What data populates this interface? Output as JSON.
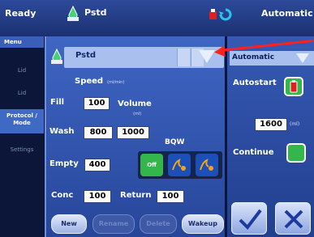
{
  "top_bar": {
    "status": "Ready",
    "program": "Pstd",
    "mode": "Automatic"
  },
  "sidebar": {
    "menu_label": "Menu",
    "items": [
      {
        "label": "Lid"
      },
      {
        "label": "Lid"
      },
      {
        "label": "Protocol / Mode"
      },
      {
        "label": "Settings"
      }
    ]
  },
  "program_panel": {
    "program_name": "Pstd",
    "speed_label": "Speed",
    "speed_unit": "(ml/min)",
    "fill_label": "Fill",
    "fill_value": "100",
    "volume_label": "Volume",
    "volume_unit": "(ml)",
    "wash_label": "Wash",
    "wash_value_1": "800",
    "wash_value_2": "1000",
    "bqw_label": "BQW",
    "empty_label": "Empty",
    "empty_value": "400",
    "toggle_off_label": "Off",
    "conc_label": "Conc",
    "conc_value": "100",
    "return_label": "Return",
    "return_value": "100",
    "buttons": {
      "new": "New",
      "rename": "Rename",
      "delete": "Delete",
      "wakeup": "Wakeup"
    }
  },
  "right_panel": {
    "mode_value": "Automatic",
    "autostart_label": "Autostart",
    "time_value": "1600",
    "time_unit": "(ml)",
    "continue_label": "Continue"
  },
  "colors": {
    "accent_green": "#33b64a",
    "accent_red": "#e02020",
    "bqw_orange": "#e8a21b"
  }
}
